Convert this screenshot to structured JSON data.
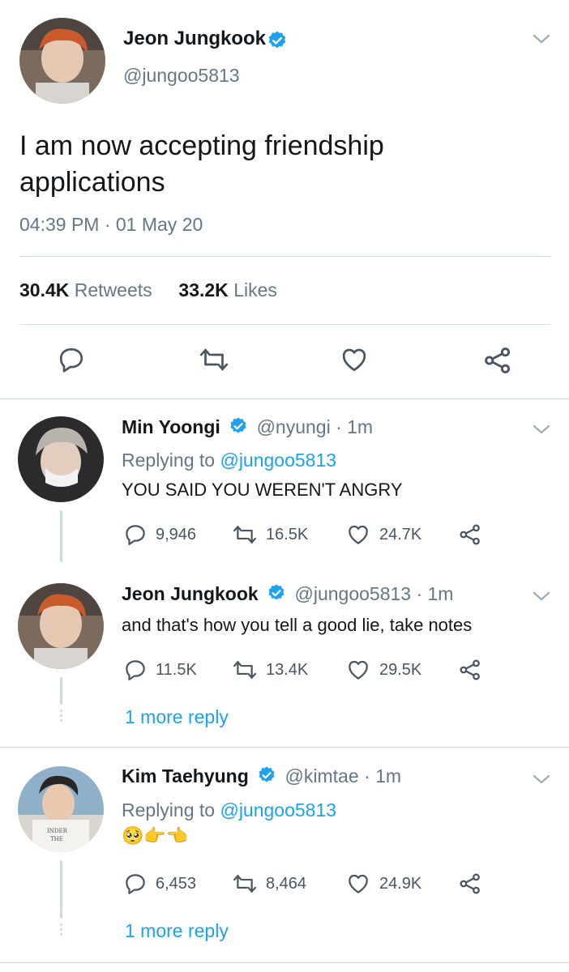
{
  "tweet": {
    "author_name": "Jeon Jungkook",
    "author_handle": "@jungoo5813",
    "text_line1": "I am now accepting friendship",
    "text_line2": "applications",
    "timestamp": "04:39 PM · 01 May 20",
    "retweets_count": "30.4K",
    "retweets_label": "Retweets",
    "likes_count": "33.2K",
    "likes_label": "Likes"
  },
  "replies": [
    {
      "author_name": "Min Yoongi",
      "author_handle": "@nyungi",
      "time": "· 1m",
      "replying_prefix": "Replying to",
      "replying_to": "@jungoo5813",
      "text": "YOU SAID YOU WEREN'T ANGRY",
      "replies": "9,946",
      "retweets": "16.5K",
      "likes": "24.7K"
    },
    {
      "author_name": "Jeon Jungkook",
      "author_handle": "@jungoo5813",
      "time": "· 1m",
      "text": "and that's how you tell a good lie, take notes",
      "replies": "11.5K",
      "retweets": "13.4K",
      "likes": "29.5K",
      "more_replies": "1 more reply"
    },
    {
      "author_name": "Kim Taehyung",
      "author_handle": "@kimtae",
      "time": "· 1m",
      "replying_prefix": "Replying to",
      "replying_to": "@jungoo5813",
      "emoji_text": "🥺👉👈",
      "replies": "6,453",
      "retweets": "8,464",
      "likes": "24.9K",
      "more_replies": "1 more reply"
    }
  ],
  "colors": {
    "link": "#1da1f2",
    "muted": "#657786",
    "verified": "#1da1f2",
    "icon": "#4a5561"
  }
}
